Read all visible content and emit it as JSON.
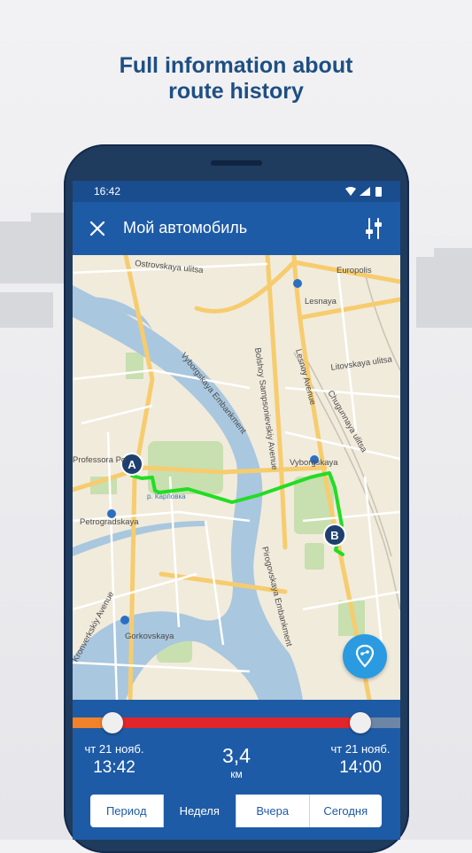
{
  "headline": {
    "line1": "Full information about",
    "line2": "route history"
  },
  "status": {
    "time": "16:42",
    "icons": [
      "wifi-icon",
      "signal-icon",
      "battery-icon"
    ]
  },
  "appbar": {
    "title": "Мой автомобиль",
    "close_icon": "close-icon",
    "filter_icon": "filter-icon"
  },
  "map": {
    "labels": {
      "ostrovskaya": "Ostrovskaya ulitsa",
      "europolis": "Europolis",
      "lesnaya": "Lesnaya",
      "litovskaya": "Litovskaya ulitsa",
      "lesnoy": "Lesnoy Avenue",
      "chugunnaya": "Chugunnaya ulitsa",
      "sampsonievsky": "Bolshoy Sampsonievskiy Avenue",
      "vyborgskaya_emb": "Vyborgskaya Embankment",
      "vyborgskaya": "Vyborgskaya",
      "professora": "Professora Po",
      "karpovka": "р. Карповка",
      "petrogradskaya": "Petrogradskaya",
      "pirogovskaya": "Pirogovskaya Embankment",
      "kronverksky": "Kronverkskiy Avenue",
      "gorkovskaya": "Gorkovskaya",
      "marker_a": "A",
      "marker_b": "B"
    },
    "route_color": "#22dd22",
    "fab_icon": "route-pin-icon"
  },
  "trip": {
    "start_date": "чт 21 нояб.",
    "start_time": "13:42",
    "distance": "3,4",
    "distance_unit": "км",
    "end_date": "чт 21 нояб.",
    "end_time": "14:00"
  },
  "tabs": [
    "Период",
    "Неделя",
    "Вчера",
    "Сегодня"
  ],
  "active_tab": "Неделя",
  "colors": {
    "primary": "#1e5ba6",
    "accent_orange": "#f0822a",
    "route_red": "#e0262a"
  }
}
